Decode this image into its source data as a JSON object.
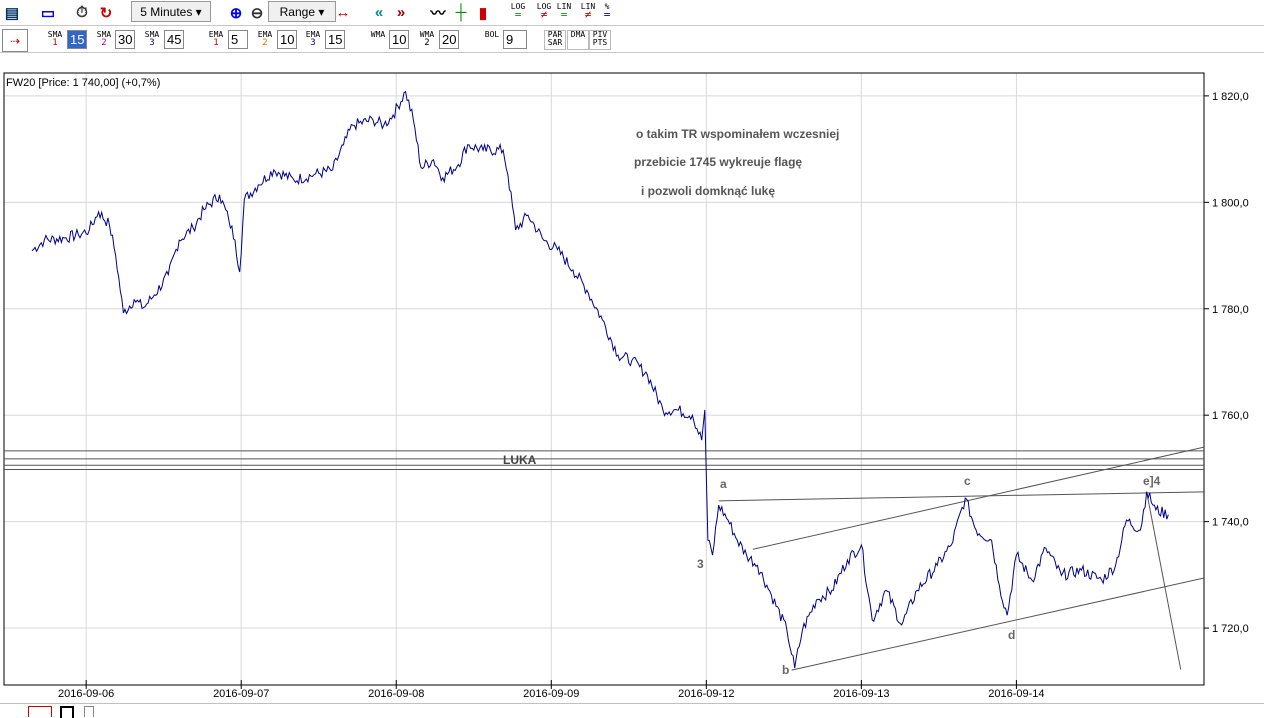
{
  "toolbar": {
    "interval": "5 Minutes",
    "range": "Range",
    "scale_buttons": [
      "LOG =",
      "LOG ≠",
      "LIN =",
      "LIN ≠",
      "% ="
    ],
    "icons": [
      "chart-settings-icon",
      "window-icon",
      "stopwatch-icon",
      "refresh-icon",
      "zoom-in-icon",
      "zoom-out-icon",
      "fit-range-icon",
      "scroll-left-icon",
      "scroll-right-icon",
      "line-chart-icon",
      "ohlc-icon",
      "candlestick-icon"
    ]
  },
  "indicators": [
    {
      "name": "SMA",
      "sub": "1",
      "value": "15",
      "sub_color": "#cc0000",
      "active": true
    },
    {
      "name": "SMA",
      "sub": "2",
      "value": "30",
      "sub_color": "#990099"
    },
    {
      "name": "SMA",
      "sub": "3",
      "value": "45",
      "sub_color": "#000099"
    },
    {
      "name": "EMA",
      "sub": "1",
      "value": "5",
      "sub_color": "#cc0000"
    },
    {
      "name": "EMA",
      "sub": "2",
      "value": "10",
      "sub_color": "#dd7700"
    },
    {
      "name": "EMA",
      "sub": "3",
      "value": "15",
      "sub_color": "#000099"
    },
    {
      "name": "WMA",
      "sub": "",
      "value": "10"
    },
    {
      "name": "WMA",
      "sub": "2",
      "value": "20",
      "sub_color": "#000"
    },
    {
      "name": "BOL",
      "sub": "",
      "value": "9"
    }
  ],
  "extra_buttons": [
    "PAR SAR",
    "DMA",
    "PIV PTS"
  ],
  "chart_header": "FW20 [Price: 1 740,00] (+0,7%)",
  "annotations": [
    "o takim TR wspominałem wczesniej",
    "przebicie 1745 wykreuje flagę",
    "i pozwoli domknąć lukę"
  ],
  "wave_labels": {
    "a": "a",
    "b": "b",
    "c": "c",
    "d": "d",
    "e": "e]4",
    "three": "3"
  },
  "gap_label": "LUKA",
  "colors": {
    "series": "#00008b",
    "drawing": "#555555",
    "grid": "#d8d8d8"
  },
  "chart_data": {
    "type": "line",
    "title": "FW20 [Price: 1 740,00] (+0,7%)",
    "x_unit": "days since 2016-09-06 (trading days)",
    "x_ticks": [
      {
        "x": 0,
        "label": "2016-09-06"
      },
      {
        "x": 1,
        "label": "2016-09-07"
      },
      {
        "x": 2,
        "label": "2016-09-08"
      },
      {
        "x": 3,
        "label": "2016-09-09"
      },
      {
        "x": 4,
        "label": "2016-09-12"
      },
      {
        "x": 5,
        "label": "2016-09-13"
      },
      {
        "x": 6,
        "label": "2016-09-14"
      }
    ],
    "y_ticks": [
      {
        "y": 1720,
        "label": "1 720,0"
      },
      {
        "y": 1740,
        "label": "1 740,0"
      },
      {
        "y": 1760,
        "label": "1 760,0"
      },
      {
        "y": 1780,
        "label": "1 780,0"
      },
      {
        "y": 1800,
        "label": "1 800,0"
      },
      {
        "y": 1820,
        "label": "1 820,0"
      }
    ],
    "xlim": [
      -0.53,
      7.21
    ],
    "ylim": [
      1709.3,
      1824.3
    ],
    "grid": true,
    "series": [
      {
        "name": "FW20",
        "points": [
          [
            -0.35,
            1790.9
          ],
          [
            -0.27,
            1792.9
          ],
          [
            -0.14,
            1793.3
          ],
          [
            -0.05,
            1793.9
          ],
          [
            0.02,
            1794.8
          ],
          [
            0.08,
            1798.2
          ],
          [
            0.15,
            1795.8
          ],
          [
            0.19,
            1790.1
          ],
          [
            0.24,
            1779.2
          ],
          [
            0.31,
            1781.7
          ],
          [
            0.37,
            1780.2
          ],
          [
            0.44,
            1782.6
          ],
          [
            0.53,
            1786.4
          ],
          [
            0.6,
            1792.9
          ],
          [
            0.69,
            1795.2
          ],
          [
            0.76,
            1798.6
          ],
          [
            0.86,
            1801.4
          ],
          [
            0.92,
            1796.7
          ],
          [
            0.96,
            1792.9
          ],
          [
            0.99,
            1786.9
          ],
          [
            1.02,
            1800.5
          ],
          [
            1.11,
            1803.3
          ],
          [
            1.21,
            1806.1
          ],
          [
            1.34,
            1804.2
          ],
          [
            1.47,
            1805.2
          ],
          [
            1.59,
            1806.1
          ],
          [
            1.66,
            1810.8
          ],
          [
            1.72,
            1814.5
          ],
          [
            1.85,
            1815.5
          ],
          [
            1.92,
            1814.5
          ],
          [
            1.98,
            1816.4
          ],
          [
            2.06,
            1820.8
          ],
          [
            2.11,
            1815.5
          ],
          [
            2.16,
            1806.5
          ],
          [
            2.24,
            1808
          ],
          [
            2.3,
            1804.6
          ],
          [
            2.4,
            1807.1
          ],
          [
            2.46,
            1810.8
          ],
          [
            2.56,
            1809.8
          ],
          [
            2.69,
            1809.8
          ],
          [
            2.72,
            1805.2
          ],
          [
            2.77,
            1794.8
          ],
          [
            2.85,
            1797.6
          ],
          [
            2.95,
            1792.9
          ],
          [
            3.04,
            1791.1
          ],
          [
            3.14,
            1787.3
          ],
          [
            3.23,
            1783.5
          ],
          [
            3.33,
            1777.9
          ],
          [
            3.43,
            1771.3
          ],
          [
            3.52,
            1770.3
          ],
          [
            3.62,
            1767.6
          ],
          [
            3.72,
            1761
          ],
          [
            3.81,
            1761
          ],
          [
            3.91,
            1760
          ],
          [
            3.97,
            1755.3
          ],
          [
            3.99,
            1761
          ],
          [
            4.01,
            1736.5
          ],
          [
            4.04,
            1733.7
          ],
          [
            4.08,
            1743.1
          ],
          [
            4.14,
            1740.3
          ],
          [
            4.2,
            1736.5
          ],
          [
            4.26,
            1733.7
          ],
          [
            4.33,
            1731.8
          ],
          [
            4.42,
            1726.2
          ],
          [
            4.52,
            1719.6
          ],
          [
            4.57,
            1712.5
          ],
          [
            4.62,
            1719.6
          ],
          [
            4.71,
            1725.3
          ],
          [
            4.81,
            1727.1
          ],
          [
            4.91,
            1732.8
          ],
          [
            5.0,
            1735.6
          ],
          [
            5.07,
            1721.5
          ],
          [
            5.16,
            1727.1
          ],
          [
            5.26,
            1720.6
          ],
          [
            5.36,
            1727.1
          ],
          [
            5.49,
            1731.8
          ],
          [
            5.58,
            1735.6
          ],
          [
            5.67,
            1744.4
          ],
          [
            5.74,
            1738.4
          ],
          [
            5.84,
            1736.5
          ],
          [
            5.89,
            1728.1
          ],
          [
            5.94,
            1722.4
          ],
          [
            6.0,
            1733.7
          ],
          [
            6.1,
            1729
          ],
          [
            6.19,
            1735
          ],
          [
            6.29,
            1729.9
          ],
          [
            6.42,
            1730.9
          ],
          [
            6.55,
            1729
          ],
          [
            6.64,
            1731.8
          ],
          [
            6.71,
            1740.3
          ],
          [
            6.8,
            1738.4
          ],
          [
            6.84,
            1745.6
          ],
          [
            6.9,
            1742.2
          ],
          [
            6.98,
            1741.3
          ]
        ]
      }
    ],
    "drawings": [
      {
        "name": "gap-line",
        "from": [
          -0.53,
          1753.3
        ],
        "to": [
          7.21,
          1753.3
        ]
      },
      {
        "name": "gap-line",
        "from": [
          -0.53,
          1751.8
        ],
        "to": [
          7.21,
          1751.8
        ]
      },
      {
        "name": "gap-line",
        "from": [
          -0.53,
          1750.6
        ],
        "to": [
          7.21,
          1750.6
        ]
      },
      {
        "name": "gap-line",
        "from": [
          -0.53,
          1749.8
        ],
        "to": [
          7.21,
          1749.8
        ]
      },
      {
        "name": "resistance-line",
        "from": [
          4.08,
          1743.9
        ],
        "to": [
          7.21,
          1745.6
        ]
      },
      {
        "name": "channel-upper",
        "from": [
          4.3,
          1734.8
        ],
        "to": [
          7.21,
          1754
        ]
      },
      {
        "name": "channel-lower",
        "from": [
          4.55,
          1712.1
        ],
        "to": [
          7.21,
          1729.4
        ]
      },
      {
        "name": "projection-line",
        "from": [
          6.84,
          1745.6
        ],
        "to": [
          7.06,
          1712.2
        ]
      }
    ]
  }
}
